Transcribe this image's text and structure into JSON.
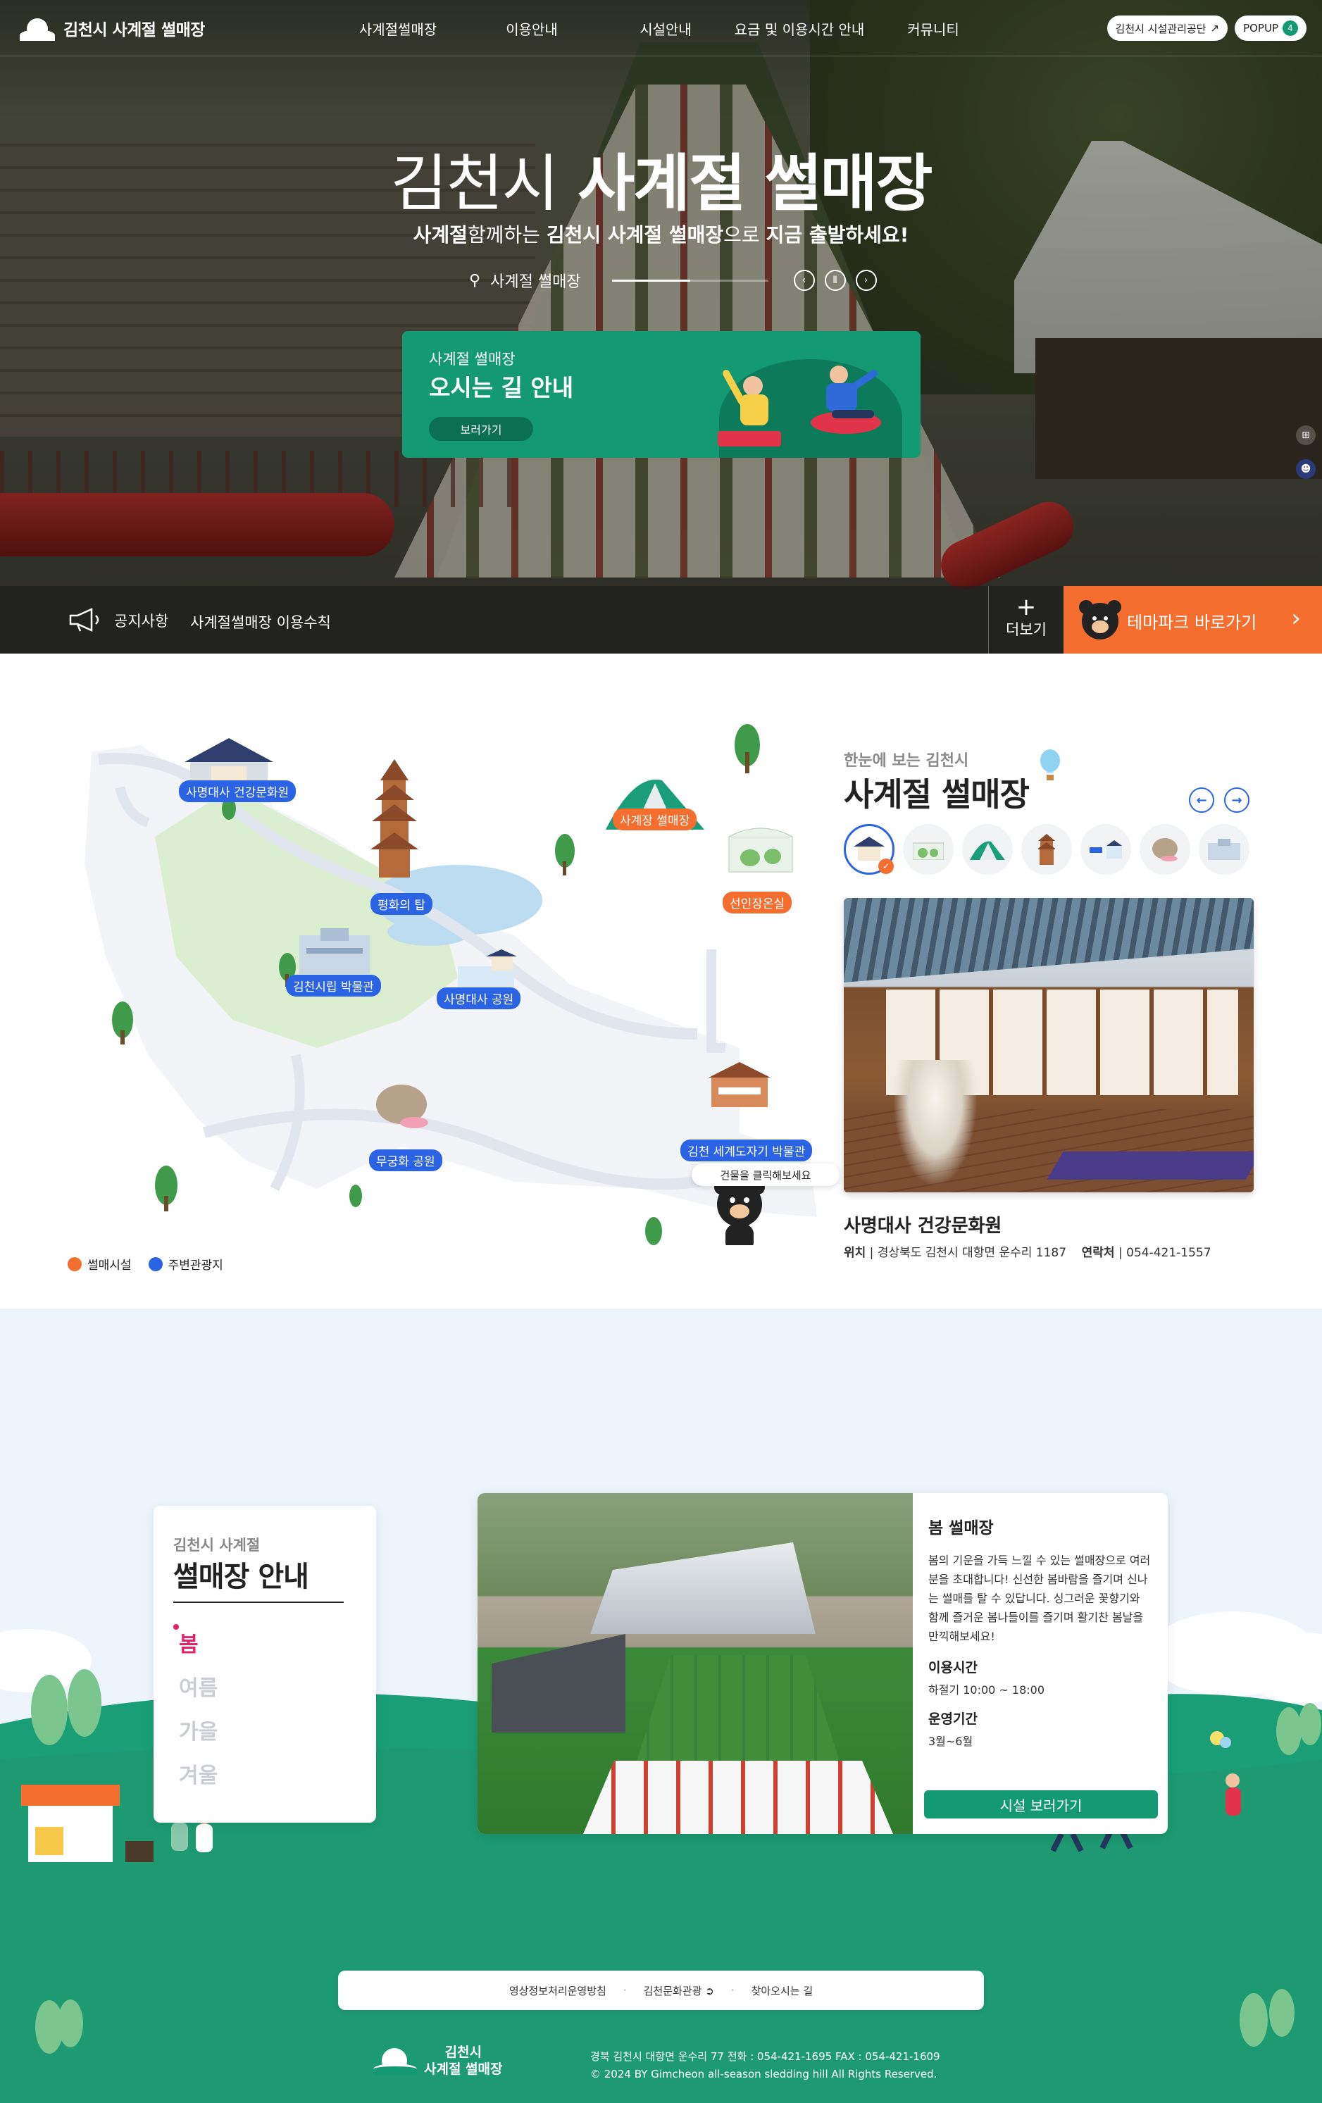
{
  "header": {
    "logo_text": "김천시 사계절 썰매장",
    "nav": [
      "사계절썰매장",
      "이용안내",
      "시설안내",
      "요금 및 이용시간 안내",
      "커뮤니티"
    ],
    "util_link": "김천시 시설관리공단",
    "popup_label": "POPUP",
    "popup_count": "4"
  },
  "hero": {
    "title_light": "김천시",
    "title_bold": "사계절 썰매장",
    "sub_b1": "사계절",
    "sub_1": "함께하는 ",
    "sub_b2": "김천시 사계절 썰매장",
    "sub_2": "으로 ",
    "sub_b3": "지금 출발하세요!",
    "location": "사계절 썰매장",
    "slide_progress": 0.5
  },
  "way_card": {
    "small": "사계절 썰매장",
    "large": "오시는 길 안내",
    "button": "보러가기"
  },
  "notice": {
    "label": "공지사항",
    "text": "사계절썰매장 이용수칙",
    "more": "더보기",
    "theme": "테마파크 바로가기"
  },
  "map": {
    "places": [
      {
        "name": "사명대사 건강문화원",
        "type": "b"
      },
      {
        "name": "사계장 썰매장",
        "type": "o"
      },
      {
        "name": "평화의 탑",
        "type": "b"
      },
      {
        "name": "선인장온실",
        "type": "o"
      },
      {
        "name": "김천시립 박물관",
        "type": "b"
      },
      {
        "name": "사명대사 공원",
        "type": "b"
      },
      {
        "name": "김천 세계도자기 박물관",
        "type": "b"
      },
      {
        "name": "무궁화 공원",
        "type": "b"
      }
    ],
    "click_hint": "건물을 클릭해보세요",
    "legend": [
      "썰매시설",
      "주변관광지"
    ],
    "colors": {
      "facility": "#f46e2f",
      "tour": "#2b63e5"
    }
  },
  "tour": {
    "kicker": "한눈에 보는 김천시",
    "title": "사계절 썰매장",
    "place_name": "사명대사 건강문화원",
    "addr_label": "위치",
    "addr": "경상북도 김천시 대항면 운수리 1187",
    "tel_label": "연락처",
    "tel": "054-421-1557"
  },
  "season": {
    "kicker": "김천시 사계절",
    "title": "썰매장 안내",
    "tabs": [
      "봄",
      "여름",
      "가을",
      "겨울"
    ],
    "active_tab": "봄",
    "info_title": "봄 썰매장",
    "info_desc": "봄의 기운을 가득 느낄 수 있는 썰매장으로 여러분을 초대합니다! 신선한 봄바람을 즐기며 신나는 썰매를 탈 수 있답니다. 싱그러운 꽃향기와 함께 즐거운 봄나들이를 즐기며 활기찬 봄날을 만끽해보세요!",
    "hours_label": "이용시간",
    "hours": "하절기 10:00 ~ 18:00",
    "period_label": "운영기간",
    "period": "3월~6월",
    "button": "시설 보러가기"
  },
  "footer": {
    "links": [
      "영상정보처리운영방침",
      "김천문화관광",
      "찾아오시는 길"
    ],
    "logo_line1": "김천시",
    "logo_line2": "사계절 썰매장",
    "addr_line": "경북 김천시 대항면 운수리 77   전화 : 054-421-1695   FAX : 054-421-1609",
    "copyright": "© 2024 BY Gimcheon all-season sledding hill All Rights Reserved."
  },
  "colors": {
    "brand": "#149a73",
    "accent": "#f46e2f",
    "blue": "#2b63e5",
    "pink": "#e0246a"
  }
}
